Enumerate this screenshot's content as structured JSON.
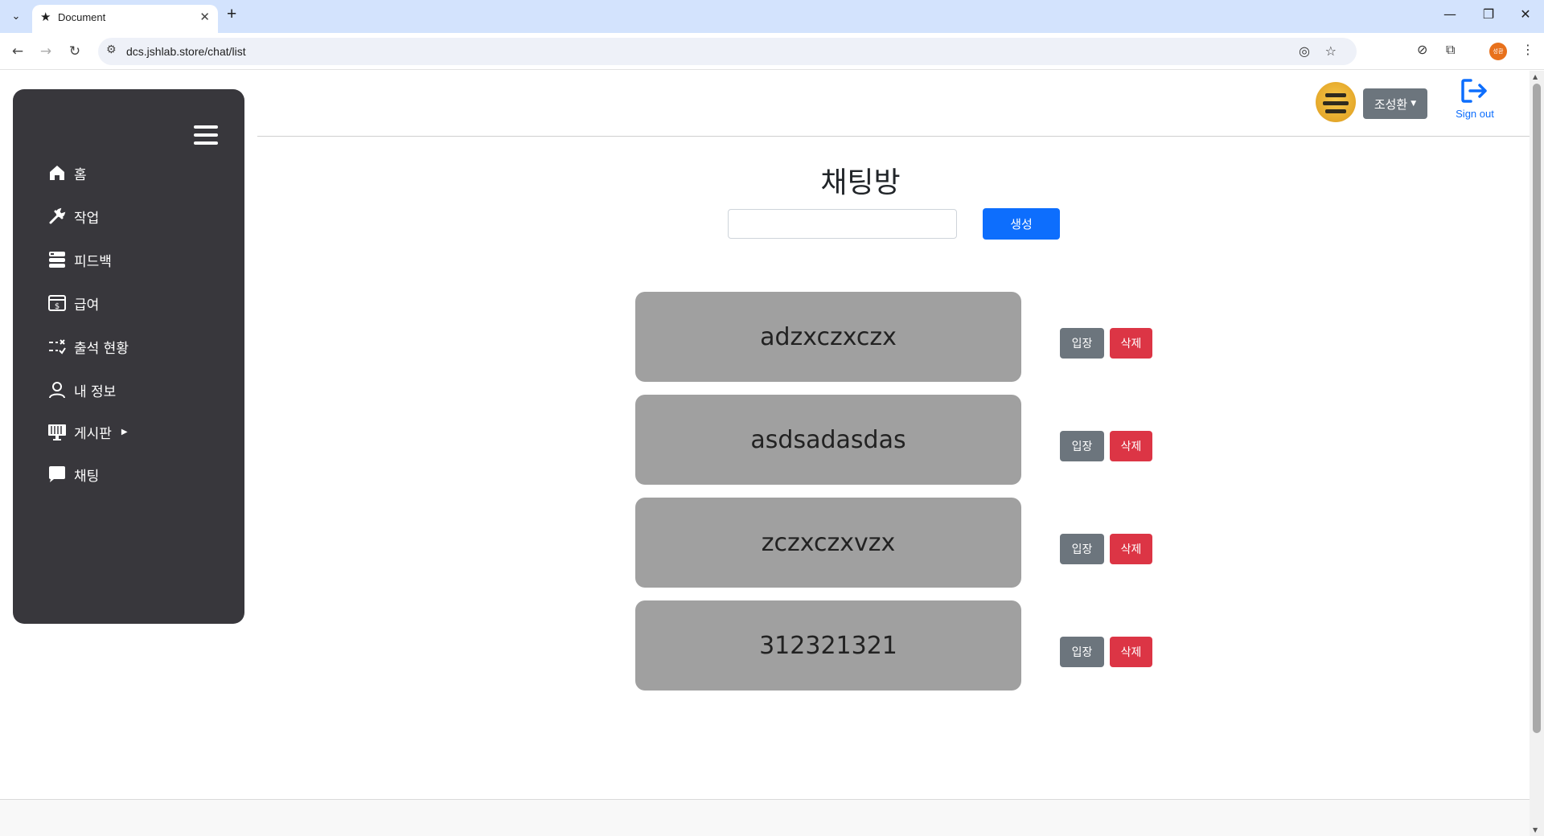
{
  "browser": {
    "tab_title": "Document",
    "url": "dcs.jshlab.store/chat/list",
    "profile_initials": "성환"
  },
  "sidebar": {
    "items": [
      {
        "label": "홈",
        "icon": "home-icon"
      },
      {
        "label": "작업",
        "icon": "tools-icon"
      },
      {
        "label": "피드백",
        "icon": "feedback-icon"
      },
      {
        "label": "급여",
        "icon": "salary-icon"
      },
      {
        "label": "출석 현황",
        "icon": "attendance-icon"
      },
      {
        "label": "내 정보",
        "icon": "user-icon"
      },
      {
        "label": "게시판",
        "icon": "board-icon"
      },
      {
        "label": "채팅",
        "icon": "chat-icon"
      }
    ]
  },
  "header": {
    "user_name": "조성환",
    "signout_label": "Sign out"
  },
  "main": {
    "title": "채팅방",
    "room_name_input": {
      "value": "",
      "placeholder": ""
    },
    "create_label": "생성",
    "enter_label": "입장",
    "delete_label": "삭제",
    "rooms": [
      {
        "name": "adzxczxczx"
      },
      {
        "name": "asdsadasdas"
      },
      {
        "name": "zczxczxvzx"
      },
      {
        "name": "312321321"
      }
    ]
  },
  "colors": {
    "sidebar_bg": "#38373c",
    "primary": "#0d6efd",
    "secondary": "#6c757d",
    "danger": "#dc3545",
    "room_card": "#a0a0a0"
  }
}
